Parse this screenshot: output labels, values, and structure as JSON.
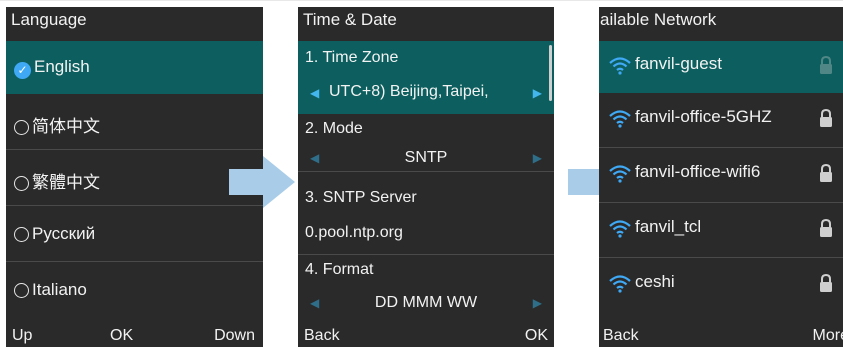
{
  "language_screen": {
    "title": "Language",
    "items": [
      {
        "label": "English",
        "selected": true
      },
      {
        "label": "简体中文",
        "selected": false
      },
      {
        "label": "繁體中文",
        "selected": false
      },
      {
        "label": "Русский",
        "selected": false
      },
      {
        "label": "Italiano",
        "selected": false
      }
    ],
    "softkeys": {
      "left": "Up",
      "center": "OK",
      "right": "Down"
    }
  },
  "time_date_screen": {
    "title": "Time & Date",
    "time_zone": {
      "label": "1. Time Zone",
      "value": "UTC+8) Beijing,Taipei,"
    },
    "mode": {
      "label": "2. Mode",
      "value": "SNTP"
    },
    "sntp_server": {
      "label": "3. SNTP Server",
      "value": "0.pool.ntp.org"
    },
    "format": {
      "label": "4. Format",
      "value": "DD MMM WW"
    },
    "softkeys": {
      "left": "Back",
      "right": "OK"
    }
  },
  "network_screen": {
    "title": "ailable Network",
    "networks": [
      {
        "name": "fanvil-guest",
        "locked": true
      },
      {
        "name": "fanvil-office-5GHZ",
        "locked": true
      },
      {
        "name": "fanvil-office-wifi6",
        "locked": true
      },
      {
        "name": "fanvil_tcl",
        "locked": true
      },
      {
        "name": "ceshi",
        "locked": true
      }
    ],
    "softkeys": {
      "left": "Back",
      "right": "More"
    }
  },
  "colors": {
    "screen_bg": "#2a2a2a",
    "highlight": "#0d5f5f",
    "accent_blue": "#3fa9f5",
    "arrow_fill": "#a9cde8"
  },
  "icons": [
    "check-icon",
    "radio-icon",
    "left-arrow-icon",
    "right-arrow-icon",
    "wifi-icon",
    "lock-icon",
    "flow-arrow-icon"
  ]
}
